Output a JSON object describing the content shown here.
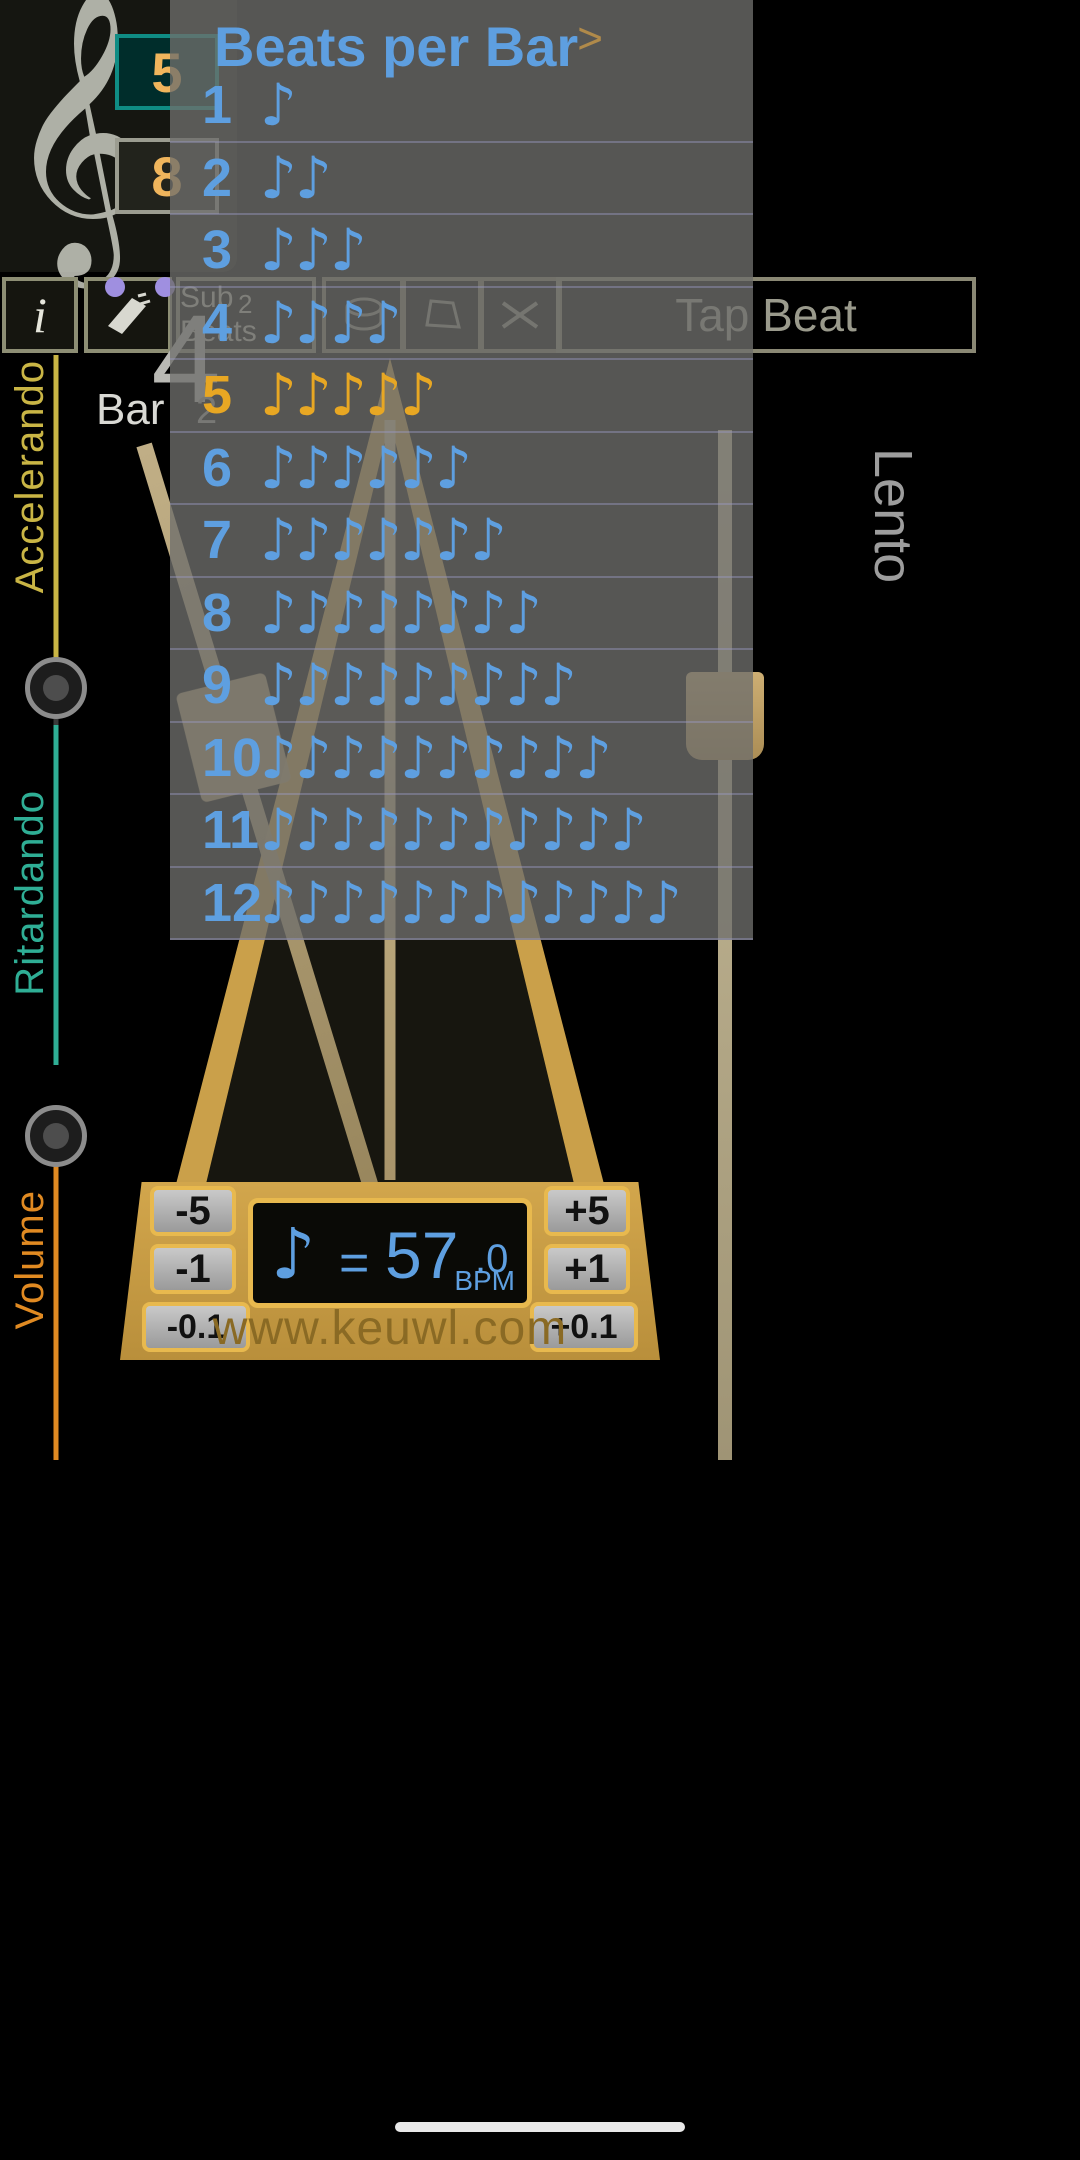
{
  "app": {
    "name": "Metronome",
    "website": "www.keuwl.com",
    "background": "#000000"
  },
  "colors": {
    "accent_blue": "#5e9fe0",
    "accent_orange": "#e8a723",
    "accel_yellow": "#c9b545",
    "ritard_teal": "#2fae95",
    "volume_orange": "#e08a22",
    "wood": "#caa04a",
    "gold_border": "#e8b94e"
  },
  "time_signature": {
    "beats": "5",
    "note_value": "8",
    "clef_icon": "treble-clef-icon"
  },
  "toolbar": {
    "info_label": "i",
    "shaker_icon": "shaker-icon",
    "sound_buttons": [
      {
        "icon": "drum-icon"
      },
      {
        "icon": "cowbell-icon"
      },
      {
        "icon": "clave-icon"
      }
    ],
    "sub_beats_label": "Sub Beats",
    "sub_beats_value": "2",
    "tap_beat_label": "Tap Beat"
  },
  "bar_counter": {
    "current_beat": "4",
    "bar_label": "Bar",
    "bar_number": "2"
  },
  "tempo_slider": {
    "accelerando_label": "Accelerando",
    "ritardando_label": "Ritardando",
    "volume_label": "Volume",
    "tempo_marking": "Lento"
  },
  "metronome": {
    "bpm_note_icon": "eighth-note-icon",
    "equals": "=",
    "bpm_whole": "57",
    "bpm_decimal": ".0",
    "bpm_unit": "BPM",
    "decrement_buttons": [
      "-5",
      "-1",
      "-0.1"
    ],
    "increment_buttons": [
      "+5",
      "+1",
      "+0.1"
    ]
  },
  "overlay": {
    "title": "Beats per Bar",
    "expand_icon": ">",
    "selected": 5,
    "rows": [
      {
        "number": "1",
        "notes": 1
      },
      {
        "number": "2",
        "notes": 2
      },
      {
        "number": "3",
        "notes": 3
      },
      {
        "number": "4",
        "notes": 4
      },
      {
        "number": "5",
        "notes": 5
      },
      {
        "number": "6",
        "notes": 6
      },
      {
        "number": "7",
        "notes": 7
      },
      {
        "number": "8",
        "notes": 8
      },
      {
        "number": "9",
        "notes": 9
      },
      {
        "number": "10",
        "notes": 10
      },
      {
        "number": "11",
        "notes": 11
      },
      {
        "number": "12",
        "notes": 12
      }
    ]
  }
}
